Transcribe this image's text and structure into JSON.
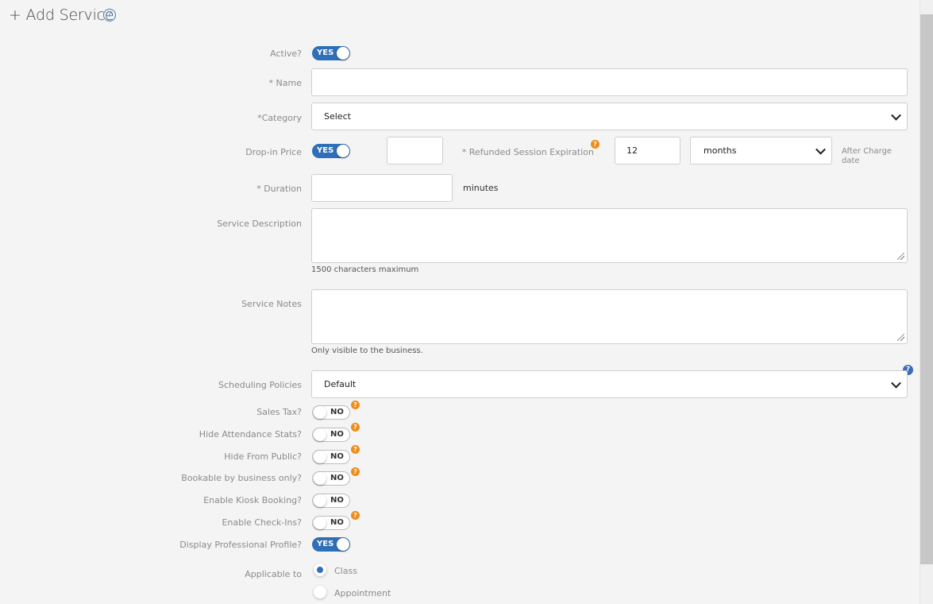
{
  "page": {
    "title": "+ Add Service",
    "help_icon": "question-circle-icon"
  },
  "form": {
    "active": {
      "label": "Active?",
      "value": "YES"
    },
    "name": {
      "label": "* Name",
      "value": ""
    },
    "category": {
      "label": "*Category",
      "value": "Select"
    },
    "dropin": {
      "label": "Drop-in Price",
      "toggle": "YES",
      "price": ""
    },
    "refund": {
      "label": "* Refunded Session Expiration",
      "value": "12",
      "unit": "months",
      "after_line1": "After Charge",
      "after_line2": "date"
    },
    "duration": {
      "label": "* Duration",
      "value": "",
      "unit": "minutes"
    },
    "description": {
      "label": "Service Description",
      "value": "",
      "hint": "1500 characters maximum"
    },
    "notes": {
      "label": "Service Notes",
      "value": "",
      "hint": "Only visible to the business."
    },
    "scheduling": {
      "label": "Scheduling Policies",
      "value": "Default"
    },
    "toggles": [
      {
        "label": "Sales Tax?",
        "value": "NO"
      },
      {
        "label": "Hide Attendance Stats?",
        "value": "NO"
      },
      {
        "label": "Hide From Public?",
        "value": "NO"
      },
      {
        "label": "Bookable by business only?",
        "value": "NO"
      },
      {
        "label": "Enable Kiosk Booking?",
        "value": "NO"
      },
      {
        "label": "Enable Check-Ins?",
        "value": "NO"
      },
      {
        "label": "Display Professional Profile?",
        "value": "YES"
      }
    ],
    "applicable": {
      "label": "Applicable to",
      "options": [
        "Class",
        "Appointment"
      ],
      "selected": "Class"
    }
  },
  "colors": {
    "accent": "#2f6fb7",
    "help_orange": "#ef8c1a",
    "help_blue": "#3a6bb5"
  }
}
